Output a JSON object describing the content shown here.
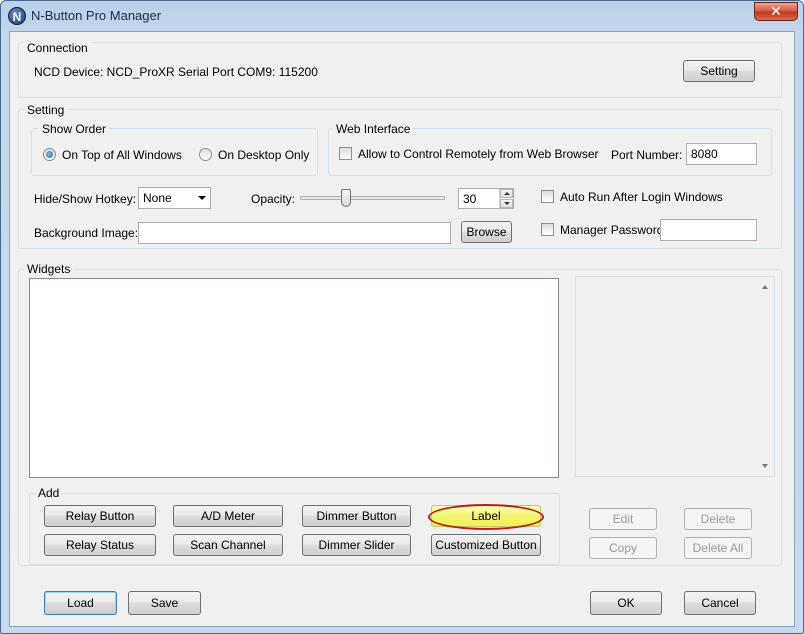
{
  "window": {
    "title": "N-Button Pro Manager",
    "icon_letter": "N",
    "close_glyph": "✕"
  },
  "connection": {
    "group_label": "Connection",
    "info_text": "NCD Device: NCD_ProXR  Serial Port  COM9: 115200",
    "setting_button": "Setting"
  },
  "setting": {
    "group_label": "Setting",
    "show_order": {
      "group_label": "Show Order",
      "options": [
        {
          "label": "On Top of All Windows",
          "checked": true
        },
        {
          "label": "On Desktop Only",
          "checked": false
        }
      ]
    },
    "web_interface": {
      "group_label": "Web Interface",
      "allow_remote_label": "Allow to Control Remotely from Web Browser",
      "port_label": "Port Number:",
      "port_value": "8080"
    },
    "hotkey_label": "Hide/Show Hotkey:",
    "hotkey_value": "None",
    "opacity_label": "Opacity:",
    "opacity_value": "30",
    "opacity_level_percent": 30,
    "auto_run_label": "Auto Run After Login Windows",
    "background_image_label": "Background Image:",
    "background_image_value": "",
    "browse_button": "Browse",
    "manager_password_label": "Manager Password",
    "manager_password_value": ""
  },
  "widgets": {
    "group_label": "Widgets",
    "add": {
      "group_label": "Add",
      "buttons": [
        "Relay Button",
        "A/D Meter",
        "Dimmer Button",
        "Label",
        "Relay Status",
        "Scan Channel",
        "Dimmer Slider",
        "Customized Button"
      ]
    },
    "edit_button": "Edit",
    "delete_button": "Delete",
    "copy_button": "Copy",
    "delete_all_button": "Delete All"
  },
  "footer": {
    "load_button": "Load",
    "save_button": "Save",
    "ok_button": "OK",
    "cancel_button": "Cancel"
  },
  "colors": {
    "title_gradient": "#b9d1ea",
    "highlight_yellow": "#f5f570",
    "highlight_ring": "#b0211f",
    "dialog_bg": "#f0f0f0"
  }
}
